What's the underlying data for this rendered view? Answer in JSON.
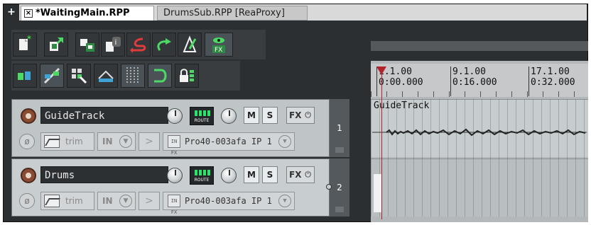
{
  "tabs": {
    "plus": "+",
    "close": "×",
    "active_label": "*WaitingMain.RPP",
    "inactive_label": "DrumsSub.RPP [ReaProxy]"
  },
  "toolbar1": {
    "icons": [
      "new-project-icon",
      "open-project-icon",
      "save-project-icon",
      "project-info-icon",
      "undo-icon",
      "redo-icon",
      "metronome-icon",
      "fx-view-icon"
    ],
    "fx_label": "FX"
  },
  "toolbar2": {
    "icons": [
      "item-grouping-icon",
      "ripple-edit-icon",
      "snap-grid-icon",
      "auto-crossfade-icon",
      "grid-lines-icon",
      "loop-icon",
      "lock-icon"
    ]
  },
  "ruler": {
    "marks": [
      {
        "bar": "1.1.00",
        "time": "0:00.000"
      },
      {
        "bar": "9.1.00",
        "time": "0:16.000"
      },
      {
        "bar": "17.1.00",
        "time": "0:32.000"
      }
    ]
  },
  "tracks": [
    {
      "number": "1",
      "name": "GuideTrack",
      "route": "ROUTE",
      "mute": "M",
      "solo": "S",
      "fx": "FX",
      "phase": "ø",
      "automation": "trim",
      "in_label": "IN",
      "input": "Pro40-003afa IP 1",
      "item_name": "GuideTrack"
    },
    {
      "number": "2",
      "name": "Drums",
      "route": "ROUTE",
      "mute": "M",
      "solo": "S",
      "fx": "FX",
      "phase": "ø",
      "automation": "trim",
      "in_label": "IN",
      "input": "Pro40-003afa IP 1"
    }
  ],
  "colors": {
    "cursor": "#b2222b",
    "route_led": "#2ee36a",
    "track_bg": "#bfc4c7"
  }
}
